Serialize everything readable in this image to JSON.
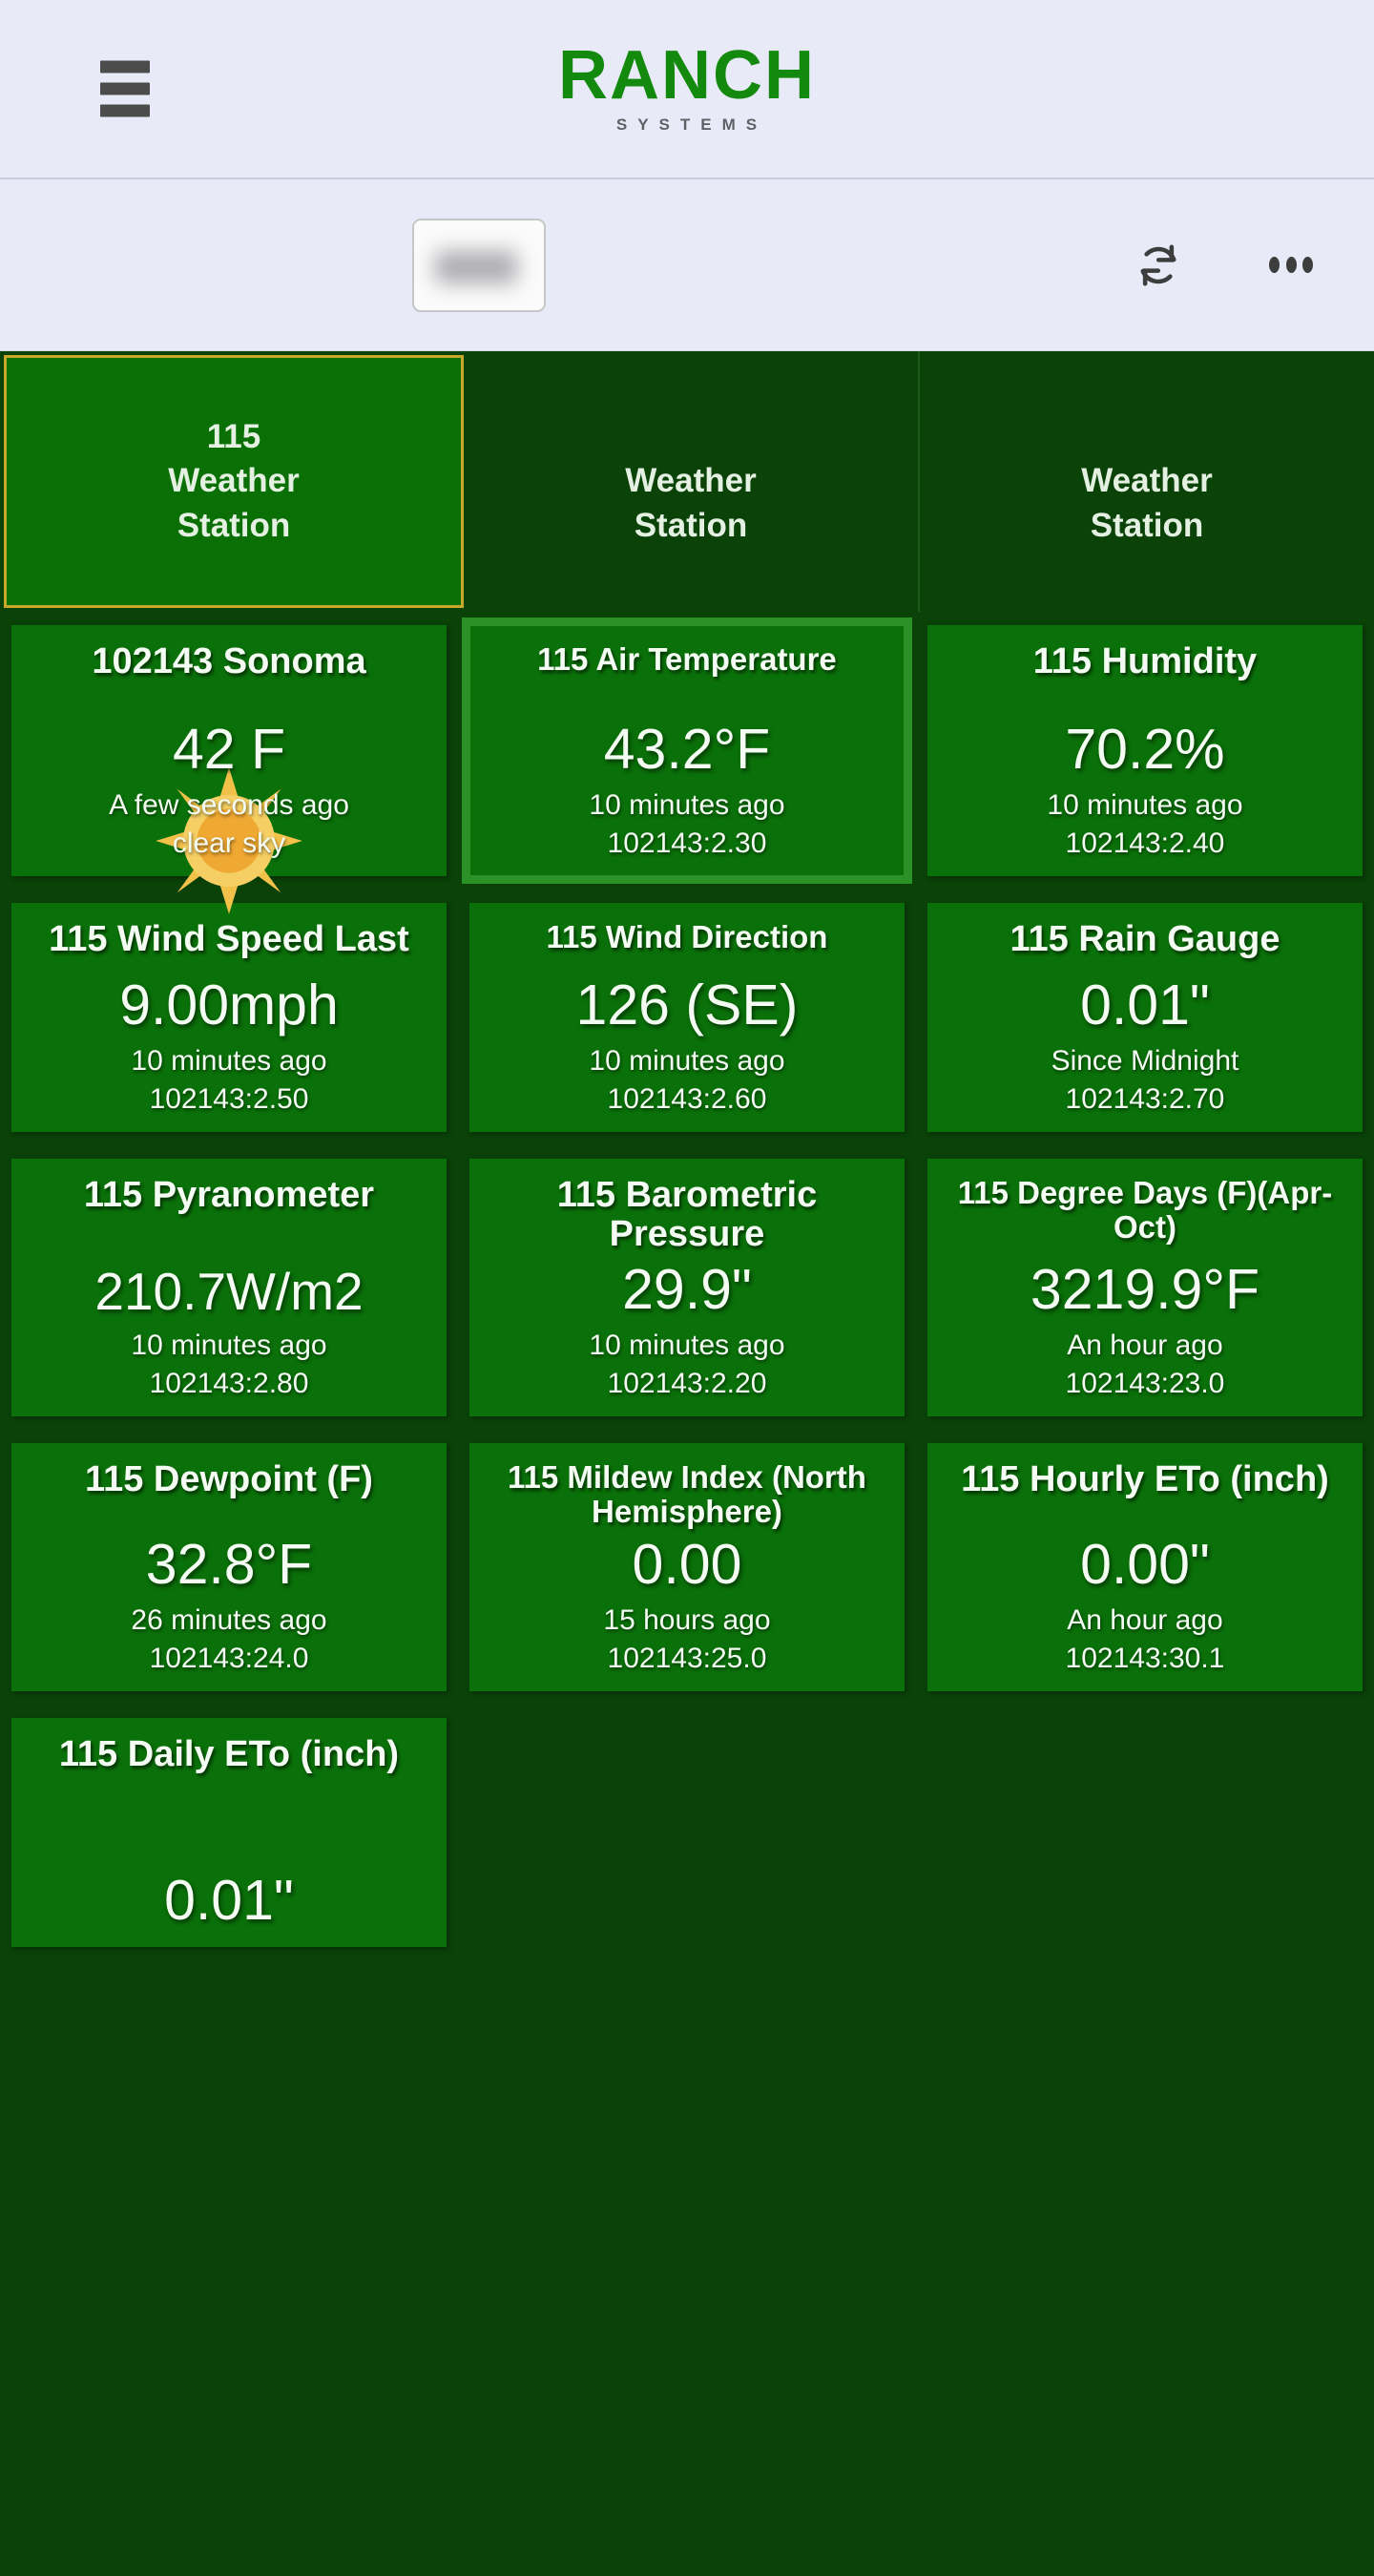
{
  "header": {
    "menu_icon": "hamburger-menu-icon",
    "brand_main": "RANCH",
    "brand_sub": "SYSTEMS"
  },
  "toolbar": {
    "search_value": "",
    "search_placeholder": "",
    "refresh_icon": "refresh-icon",
    "more_icon": "more-options-icon"
  },
  "station_tabs": [
    {
      "id": "115",
      "label_line1": "115",
      "label_line2": "Weather",
      "label_line3": "Station",
      "active": true,
      "redacted": false
    },
    {
      "id": "",
      "label_line1": "",
      "label_line2": "Weather",
      "label_line3": "Station",
      "active": false,
      "redacted": true
    },
    {
      "id": "",
      "label_line1": "",
      "label_line2": "Weather",
      "label_line3": "Station",
      "active": false,
      "redacted": true
    }
  ],
  "cards": [
    {
      "title": "102143 Sonoma",
      "value": "42 F",
      "when": "A few seconds ago",
      "id": "clear sky",
      "icon": "sun-icon",
      "highlight": false,
      "type": "weather"
    },
    {
      "title": "115 Air Temperature",
      "value": "43.2°F",
      "when": "10 minutes ago",
      "id": "102143:2.30",
      "highlight": true,
      "type": "sensor"
    },
    {
      "title": "115 Humidity",
      "value": "70.2%",
      "when": "10 minutes ago",
      "id": "102143:2.40",
      "highlight": false,
      "type": "sensor"
    },
    {
      "title": "115 Wind Speed Last",
      "value": "9.00mph",
      "when": "10 minutes ago",
      "id": "102143:2.50",
      "highlight": false,
      "type": "sensor"
    },
    {
      "title": "115 Wind Direction",
      "value": "126 (SE)",
      "when": "10 minutes ago",
      "id": "102143:2.60",
      "highlight": false,
      "type": "sensor"
    },
    {
      "title": "115 Rain Gauge",
      "value": "0.01\"",
      "when": "Since Midnight",
      "id": "102143:2.70",
      "highlight": false,
      "type": "sensor"
    },
    {
      "title": "115 Pyranometer",
      "value": "210.7W/m2",
      "when": "10 minutes ago",
      "id": "102143:2.80",
      "highlight": false,
      "type": "sensor"
    },
    {
      "title": "115 Barometric Pressure",
      "value": "29.9\"",
      "when": "10 minutes ago",
      "id": "102143:2.20",
      "highlight": false,
      "type": "sensor"
    },
    {
      "title": "115 Degree Days (F)(Apr-Oct)",
      "value": "3219.9°F",
      "when": "An hour ago",
      "id": "102143:23.0",
      "highlight": false,
      "type": "sensor"
    },
    {
      "title": "115 Dewpoint (F)",
      "value": "32.8°F",
      "when": "26 minutes ago",
      "id": "102143:24.0",
      "highlight": false,
      "type": "sensor"
    },
    {
      "title": "115 Mildew Index (North Hemisphere)",
      "value": "0.00",
      "when": "15 hours ago",
      "id": "102143:25.0",
      "highlight": false,
      "type": "sensor"
    },
    {
      "title": "115 Hourly ETo (inch)",
      "value": "0.00\"",
      "when": "An hour ago",
      "id": "102143:30.1",
      "highlight": false,
      "type": "sensor"
    },
    {
      "title": "115 Daily ETo (inch)",
      "value": "0.01\"",
      "when": "",
      "id": "",
      "highlight": false,
      "type": "sensor"
    }
  ],
  "colors": {
    "page_background": "#0a4208",
    "card_green": "#0a7009",
    "brand_green": "#138a0e",
    "topbar_background": "#e8ebf7",
    "active_tab_border": "#c8a82b",
    "highlight_border": "#2a9227"
  }
}
